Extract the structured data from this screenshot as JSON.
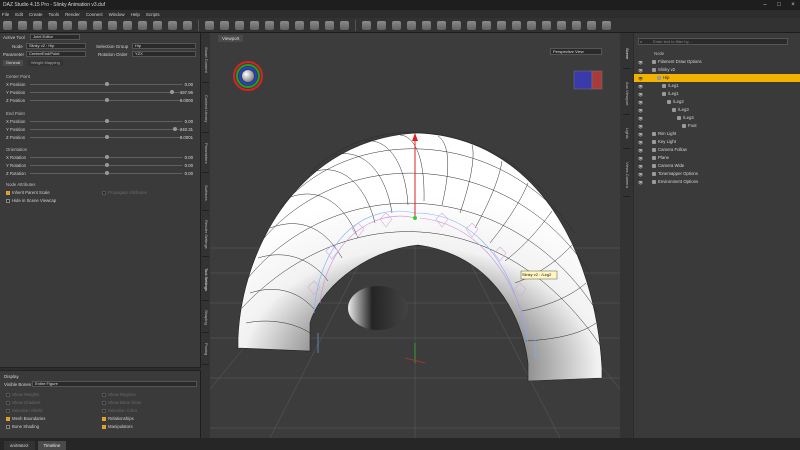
{
  "window": {
    "title": "DAZ Studio 4.15 Pro - Slinky Animation v3.duf"
  },
  "menu": [
    "File",
    "Edit",
    "Create",
    "Tools",
    "Render",
    "Connect",
    "Window",
    "Help",
    "Scripts"
  ],
  "tool_settings": {
    "active_tool_label": "Active Tool",
    "active_tool_value": "Joint Editor",
    "node_label": "Node",
    "node_value": "Slinky v2 : Hip",
    "selection_group_label": "Selection Group",
    "selection_group_value": "Hip",
    "parameter_label": "Parameter",
    "parameter_value": "Center/End/Point",
    "rotation_order_label": "Rotation Order",
    "rotation_order_value": "YZX",
    "tabs": [
      "General",
      "Weight Mapping"
    ],
    "center_point_label": "Center Point",
    "end_point_label": "End Point",
    "orientation_label": "Orientation",
    "node_attributes_label": "Node Attributes",
    "props": [
      {
        "label": "X Position",
        "value": "0.00",
        "pos": 0.5
      },
      {
        "label": "Y Position",
        "value": "197.96",
        "pos": 0.93
      },
      {
        "label": "Z Position",
        "value": "0.0000",
        "pos": 0.5
      },
      {
        "label": "X Position",
        "value": "0.00",
        "pos": 0.5
      },
      {
        "label": "Y Position",
        "value": "240.31",
        "pos": 0.95
      },
      {
        "label": "Z Position",
        "value": "0.0001",
        "pos": 0.5
      },
      {
        "label": "X Rotation",
        "value": "0.00",
        "pos": 0.5
      },
      {
        "label": "Y Rotation",
        "value": "0.00",
        "pos": 0.5
      },
      {
        "label": "Z Rotation",
        "value": "0.00",
        "pos": 0.5
      }
    ],
    "inherit_parent_scale": "Inherit Parent Scale",
    "propagate_attributes": "Propagate Attributes",
    "hide_scene_viewcap": "Hide in Scene Viewcap",
    "display_label": "Display",
    "visible_bones_label": "Visible Bones",
    "visible_bones_value": "Entire Figure",
    "display_options_left": [
      {
        "label": "Show Weights",
        "checked": false,
        "enabled": false
      },
      {
        "label": "Show Gradient",
        "checked": false,
        "enabled": false
      },
      {
        "label": "Selection Shells",
        "checked": false,
        "enabled": false
      },
      {
        "label": "Mesh Boundaries",
        "checked": true,
        "enabled": true
      },
      {
        "label": "Bone Shading",
        "checked": false,
        "enabled": true
      }
    ],
    "display_options_right": [
      {
        "label": "Show Regions",
        "checked": false,
        "enabled": false
      },
      {
        "label": "Show Bone Glow",
        "checked": false,
        "enabled": false
      },
      {
        "label": "Selection Color",
        "checked": false,
        "enabled": false
      },
      {
        "label": "Relationships",
        "checked": true,
        "enabled": true
      },
      {
        "label": "Manipulators",
        "checked": true,
        "enabled": true
      }
    ]
  },
  "left_tabs": [
    "Smart Content",
    "Content Library",
    "Parameters",
    "Surfaces",
    "Render Settings",
    "Tool Settings",
    "Shaping",
    "Posing"
  ],
  "right_tabs": [
    "Scene",
    "Aux Viewport",
    "Lights",
    "Views Camera"
  ],
  "viewport": {
    "tab": "Viewport",
    "view": "Perspective View",
    "tooltip": "Slinky v2 : /Leg2"
  },
  "scene": {
    "search_placeholder": "Enter text to filter by...",
    "header": "Node",
    "items": [
      {
        "label": "Filament Draw Options",
        "depth": 0,
        "selected": false
      },
      {
        "label": "Slinky v2",
        "depth": 0,
        "selected": false
      },
      {
        "label": "Hip",
        "depth": 1,
        "selected": true
      },
      {
        "label": "/Leg1",
        "depth": 2,
        "selected": false
      },
      {
        "label": "/Leg1",
        "depth": 2,
        "selected": false
      },
      {
        "label": "/Leg2",
        "depth": 3,
        "selected": false
      },
      {
        "label": "/Leg3",
        "depth": 4,
        "selected": false
      },
      {
        "label": "/Leg4",
        "depth": 5,
        "selected": false
      },
      {
        "label": "Foot",
        "depth": 6,
        "selected": false
      },
      {
        "label": "Rim Light",
        "depth": 0,
        "selected": false
      },
      {
        "label": "Key Light",
        "depth": 0,
        "selected": false
      },
      {
        "label": "Camera Follow",
        "depth": 0,
        "selected": false
      },
      {
        "label": "Plane",
        "depth": 0,
        "selected": false
      },
      {
        "label": "Camera Wide",
        "depth": 0,
        "selected": false
      },
      {
        "label": "Tonemapper Options",
        "depth": 0,
        "selected": false
      },
      {
        "label": "Environment Options",
        "depth": 0,
        "selected": false
      }
    ]
  },
  "bottom_tabs": [
    {
      "label": "aniMate2",
      "active": false
    },
    {
      "label": "Timeline",
      "active": true
    }
  ]
}
